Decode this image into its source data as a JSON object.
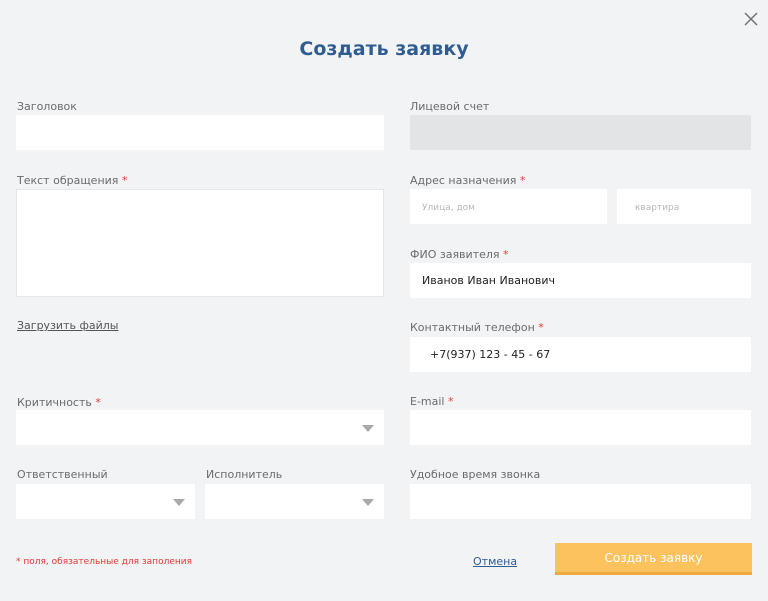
{
  "title": "Создать заявку",
  "close_icon": "close-icon",
  "left": {
    "subject_label": "Заголовок",
    "subject_value": "",
    "text_label": "Текст обращения",
    "text_value": "",
    "upload_link": "Загрузить файлы",
    "criticality_label": "Критичность",
    "criticality_value": "",
    "responsible_label": "Ответственный",
    "responsible_value": "",
    "executor_label": "Исполнитель",
    "executor_value": ""
  },
  "right": {
    "account_label": "Лицевой счет",
    "account_value": "",
    "address_label": "Адрес назначения",
    "street_placeholder": "Улица, дом",
    "apartment_placeholder": "квартира",
    "fio_label": "ФИО заявителя",
    "fio_value": "Иванов Иван Иванович",
    "phone_label": "Контактный телефон",
    "phone_value": "+7(937) 123 - 45 - 67",
    "email_label": "E-mail",
    "email_value": "",
    "call_time_label": "Удобное время звонка",
    "call_time_value": ""
  },
  "required_mark": "*",
  "footer": {
    "required_note": "* поля, обязательные для заполения",
    "cancel_label": "Отмена",
    "submit_label": "Создать заявку"
  },
  "colors": {
    "title": "#2f5d92",
    "required": "#e53935",
    "submit": "#fbc25e"
  }
}
